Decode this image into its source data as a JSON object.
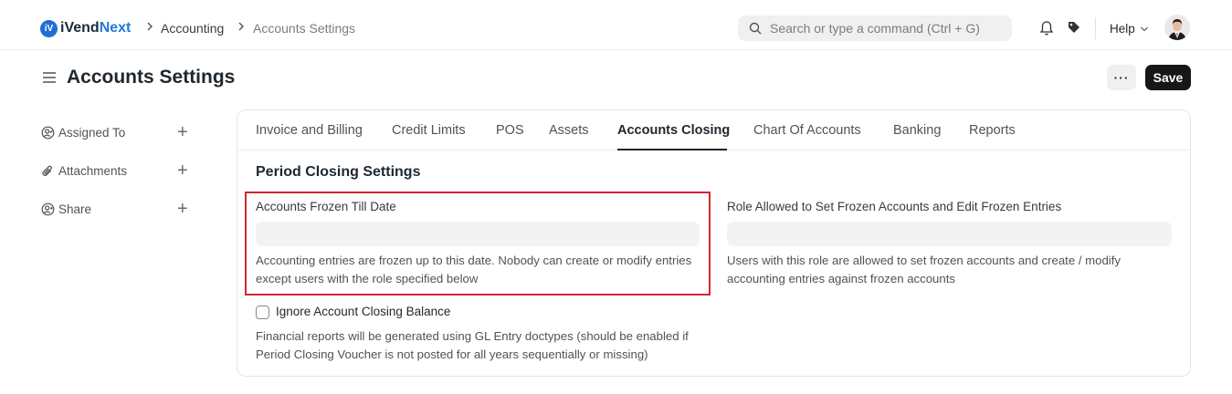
{
  "app": {
    "logo_mark": "iV",
    "brand_main": "iVend",
    "brand_accent": "Next",
    "brand_color": "#1f6fd1"
  },
  "breadcrumb": [
    "Accounting",
    "Accounts Settings"
  ],
  "search": {
    "placeholder": "Search or type a command (Ctrl + G)"
  },
  "navbar": {
    "icons": [
      "bell-icon",
      "tag-icon"
    ],
    "help_label": "Help"
  },
  "page": {
    "title": "Accounts Settings",
    "more_label": "···",
    "save_label": "Save"
  },
  "sidebar": {
    "items": [
      {
        "label": "Assigned To",
        "icon": "assign-user-icon"
      },
      {
        "label": "Attachments",
        "icon": "paperclip-icon"
      },
      {
        "label": "Share",
        "icon": "share-user-icon"
      }
    ],
    "add_symbol": "+"
  },
  "tabs": [
    {
      "label": "Invoice and Billing",
      "active": false
    },
    {
      "label": "Credit Limits",
      "active": false
    },
    {
      "label": "POS",
      "active": false
    },
    {
      "label": "Assets",
      "active": false
    },
    {
      "label": "Accounts Closing",
      "active": true
    },
    {
      "label": "Chart Of Accounts",
      "active": false
    },
    {
      "label": "Banking",
      "active": false
    },
    {
      "label": "Reports",
      "active": false
    }
  ],
  "section": {
    "title": "Period Closing Settings",
    "frozen_date": {
      "label": "Accounts Frozen Till Date",
      "value": "",
      "description": "Accounting entries are frozen up to this date. Nobody can create or modify entries except users with the role specified below"
    },
    "frozen_role": {
      "label": "Role Allowed to Set Frozen Accounts and Edit Frozen Entries",
      "value": "",
      "description": "Users with this role are allowed to set frozen accounts and create / modify accounting entries against frozen accounts"
    },
    "ignore_closing": {
      "label": "Ignore Account Closing Balance",
      "checked": false,
      "description": "Financial reports will be generated using GL Entry doctypes (should be enabled if Period Closing Voucher is not posted for all years sequentially or missing)"
    }
  },
  "colors": {
    "highlight_border": "#d32731",
    "primary_button": "#171717"
  }
}
